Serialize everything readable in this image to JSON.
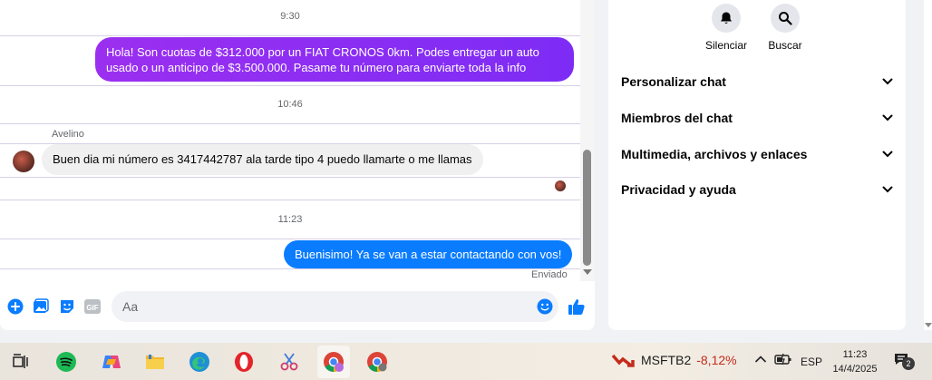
{
  "chat": {
    "timestamps": [
      "9:30",
      "10:46",
      "11:23"
    ],
    "messages": [
      {
        "direction": "outgoing",
        "text": "Hola! Son cuotas de $312.000 por un FIAT CRONOS 0km. Podes entregar un auto usado o un anticipo de $3.500.000. Pasame tu número para enviarte toda la info"
      },
      {
        "direction": "incoming",
        "sender": "Avelino",
        "text": "Buen dia mi número es 3417442787 ala tarde tipo 4 puedo llamarte o me llamas"
      },
      {
        "direction": "outgoing",
        "text": "Buenisimo! Ya se van a estar contactando con vos!"
      }
    ],
    "status": "Enviado",
    "composer": {
      "placeholder": "Aa",
      "gif_label": "GIF"
    }
  },
  "info_panel": {
    "actions": [
      {
        "icon": "bell-icon",
        "label": "Silenciar"
      },
      {
        "icon": "search-icon",
        "label": "Buscar"
      }
    ],
    "sections": [
      "Personalizar chat",
      "Miembros del chat",
      "Multimedia, archivos y enlaces",
      "Privacidad y ayuda"
    ]
  },
  "taskbar": {
    "stock": {
      "name": "MSFTB2",
      "change": "-8,12%"
    },
    "language": "ESP",
    "time": "11:23",
    "date": "14/4/2025",
    "notification_count": "2"
  },
  "colors": {
    "messenger_purple": "#8a2be2",
    "messenger_blue": "#0a7cff",
    "stock_down": "#c42b1c"
  }
}
